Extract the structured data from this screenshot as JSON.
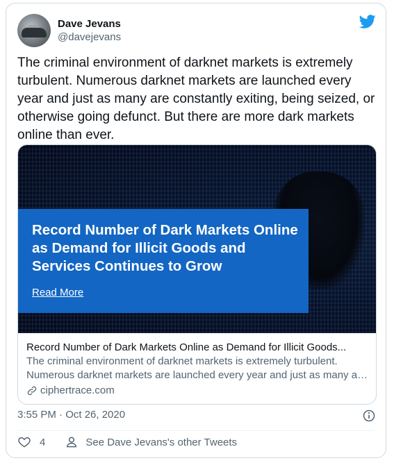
{
  "author": {
    "name": "Dave Jevans",
    "handle": "@davejevans"
  },
  "brand_color": "#1d9bf0",
  "tweet_text": "The criminal environment of darknet markets is extremely turbulent. Numerous darknet markets are launched every year and just as many are constantly exiting, being seized, or otherwise going defunct. But there are more dark markets online than ever.",
  "link_card": {
    "banner_title": "Record Number of Dark Markets Online as Demand for Illicit Goods and Services Continues to Grow",
    "banner_cta": "Read More",
    "title": "Record Number of Dark Markets Online as Demand for Illicit Goods...",
    "description_line1": "The criminal environment of darknet markets is extremely turbulent.",
    "description_line2": "Numerous darknet markets are launched every year and just as many are...",
    "domain": "ciphertrace.com"
  },
  "timestamp": "3:55 PM · Oct 26, 2020",
  "actions": {
    "like_count": "4",
    "other_tweets_label": "See Dave Jevans's other Tweets"
  },
  "icons": [
    "twitter-logo-icon",
    "info-icon",
    "heart-icon",
    "person-icon",
    "link-icon"
  ]
}
